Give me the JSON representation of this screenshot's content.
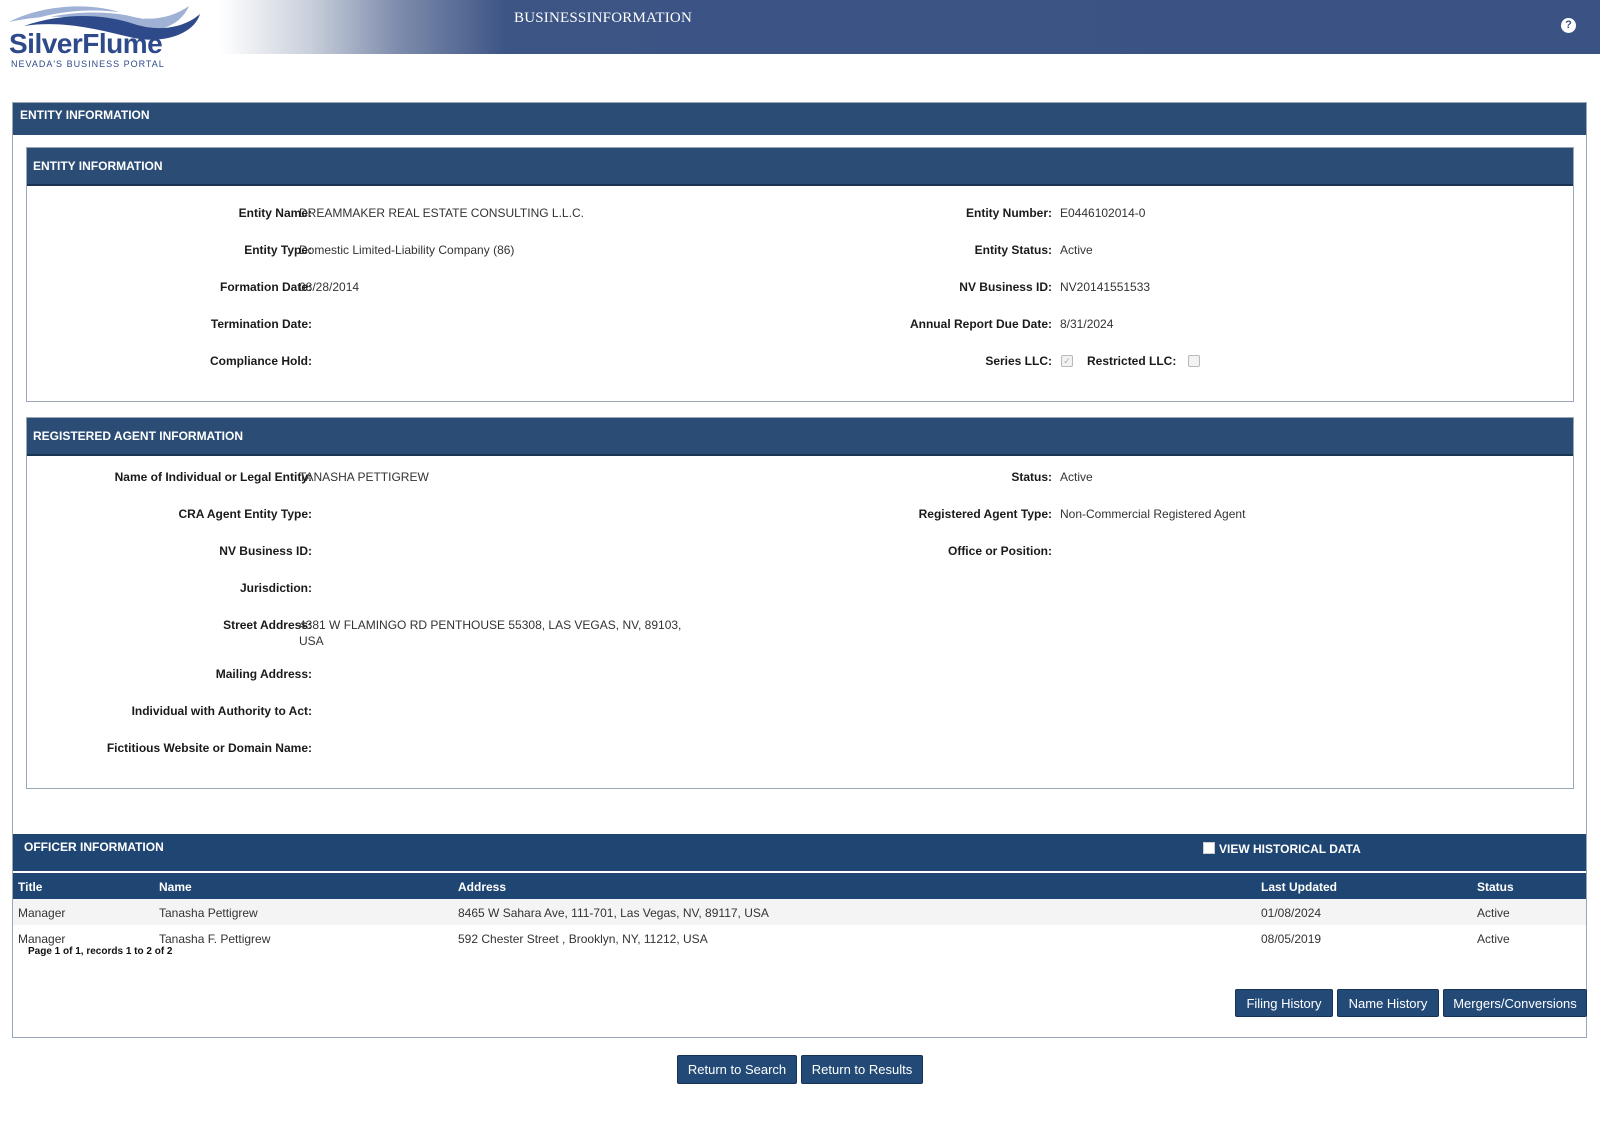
{
  "header": {
    "logo_text": "SilverFlume",
    "logo_subtitle": "NEVADA'S BUSINESS PORTAL",
    "title": "BUSINESSINFORMATION",
    "help_icon": "?"
  },
  "outer": {
    "heading": "ENTITY INFORMATION"
  },
  "entity": {
    "heading": "ENTITY INFORMATION",
    "entity_name_label": "Entity Name:",
    "entity_name": "DREAMMAKER REAL ESTATE CONSULTING L.L.C.",
    "entity_type_label": "Entity Type:",
    "entity_type": "Domestic Limited-Liability Company (86)",
    "formation_date_label": "Formation Date:",
    "formation_date": "08/28/2014",
    "termination_date_label": "Termination Date:",
    "termination_date": "",
    "compliance_hold_label": "Compliance Hold:",
    "compliance_hold": "",
    "entity_number_label": "Entity Number:",
    "entity_number": "E0446102014-0",
    "entity_status_label": "Entity Status:",
    "entity_status": "Active",
    "nv_business_id_label": "NV Business ID:",
    "nv_business_id": "NV20141551533",
    "annual_report_label": "Annual Report Due Date:",
    "annual_report_due": "8/31/2024",
    "series_llc_label": "Series LLC:",
    "series_llc_checked": true,
    "restricted_llc_label": "Restricted LLC:",
    "restricted_llc_checked": false
  },
  "agent": {
    "heading": "REGISTERED AGENT INFORMATION",
    "name_label": "Name of Individual or Legal Entity:",
    "name": "TANASHA PETTIGREW",
    "cra_type_label": "CRA Agent Entity Type:",
    "nv_business_id_label": "NV Business ID:",
    "jurisdiction_label": "Jurisdiction:",
    "street_label": "Street Address:",
    "street_line1": "4381 W FLAMINGO RD PENTHOUSE 55308, LAS VEGAS, NV, 89103,",
    "street_line2": "USA",
    "mailing_label": "Mailing Address:",
    "authority_label": "Individual with Authority to Act:",
    "website_label": "Fictitious Website or Domain Name:",
    "status_label": "Status:",
    "status": "Active",
    "agent_type_label": "Registered Agent Type:",
    "agent_type": "Non-Commercial Registered Agent",
    "office_label": "Office or Position:"
  },
  "officers": {
    "heading": "OFFICER INFORMATION",
    "view_historical_label": "VIEW HISTORICAL DATA",
    "columns": [
      "Title",
      "Name",
      "Address",
      "Last Updated",
      "Status"
    ],
    "rows": [
      [
        "Manager",
        "Tanasha Pettigrew",
        "8465 W Sahara Ave, 111-701, Las Vegas, NV, 89117, USA",
        "01/08/2024",
        "Active"
      ],
      [
        "Manager",
        "Tanasha F. Pettigrew",
        "592 Chester Street , Brooklyn, NY, 11212, USA",
        "08/05/2019",
        "Active"
      ]
    ],
    "pager": "Page 1 of 1, records 1 to 2 of 2"
  },
  "buttons": {
    "filing_history": "Filing History",
    "name_history": "Name History",
    "mergers": "Mergers/Conversions",
    "return_search": "Return to Search",
    "return_results": "Return to Results"
  }
}
